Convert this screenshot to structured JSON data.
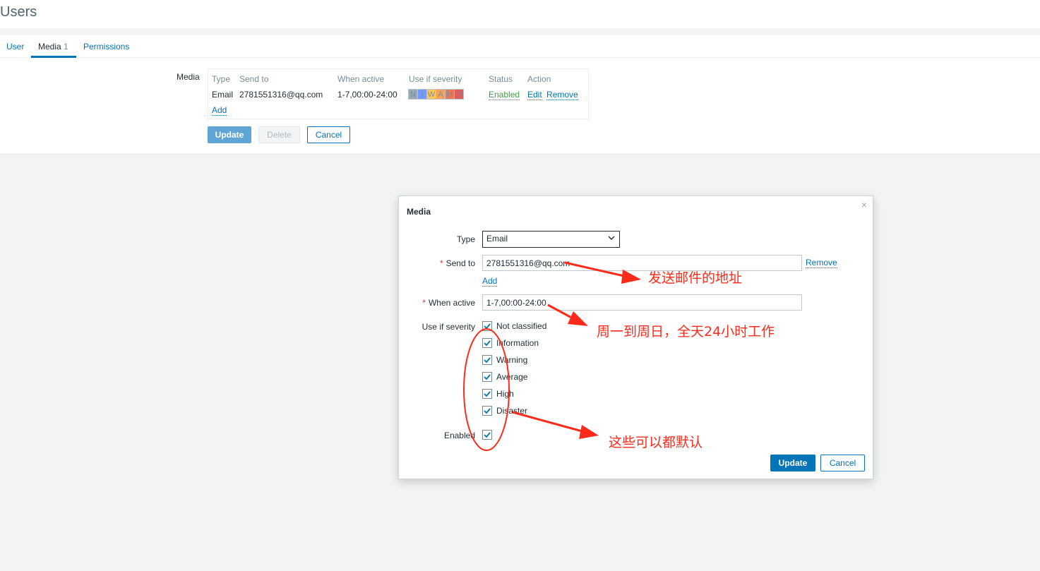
{
  "page": {
    "title": "Users"
  },
  "tabs": [
    {
      "label": "User"
    },
    {
      "label": "Media",
      "count": "1"
    },
    {
      "label": "Permissions"
    }
  ],
  "form": {
    "media_label": "Media",
    "table": {
      "headers": {
        "type": "Type",
        "send_to": "Send to",
        "when_active": "When active",
        "severity": "Use if severity",
        "status": "Status",
        "action": "Action"
      },
      "row": {
        "type": "Email",
        "send_to": "2781551316@qq.com",
        "when_active": "1-7,00:00-24:00",
        "severity": [
          "N",
          "I",
          "W",
          "A",
          "H",
          "D"
        ],
        "status": "Enabled",
        "edit": "Edit",
        "remove": "Remove"
      },
      "add": "Add"
    },
    "buttons": {
      "update": "Update",
      "delete": "Delete",
      "cancel": "Cancel"
    }
  },
  "dialog": {
    "title": "Media",
    "close": "×",
    "type_label": "Type",
    "type_value": "Email",
    "send_to_label": "Send to",
    "send_to_value": "2781551316@qq.com",
    "remove": "Remove",
    "add": "Add",
    "when_active_label": "When active",
    "when_active_value": "1-7,00:00-24:00",
    "severity_label": "Use if severity",
    "severities": [
      "Not classified",
      "Information",
      "Warning",
      "Average",
      "High",
      "Disaster"
    ],
    "enabled_label": "Enabled",
    "buttons": {
      "update": "Update",
      "cancel": "Cancel"
    }
  },
  "annotations": {
    "send_to_note": "发送邮件的地址",
    "when_active_note": "周一到周日，全天24小时工作",
    "defaults_note": "这些可以都默认"
  },
  "colors": {
    "accent": "#0275b8",
    "enabled": "#429e47",
    "annotation": "#ff2a1a",
    "sev_not_classified": "#97aab3",
    "sev_information": "#7499ff",
    "sev_warning": "#ffc859",
    "sev_average": "#ffa059",
    "sev_high": "#e97659",
    "sev_disaster": "#e45959"
  }
}
